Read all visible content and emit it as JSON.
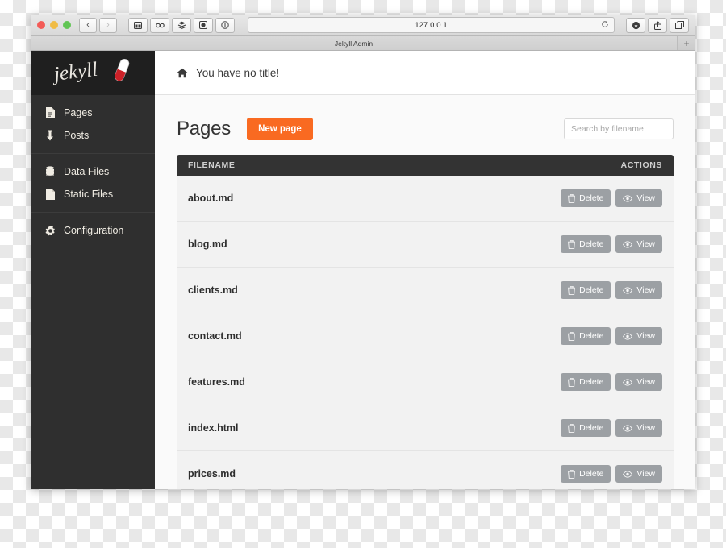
{
  "browser": {
    "url": "127.0.0.1",
    "tab_title": "Jekyll Admin",
    "new_tab_label": "+",
    "back_label": "‹",
    "forward_label": "›",
    "reload_label": "reload-icon",
    "toolbar_icons": [
      "sidebar-icon",
      "link-icon",
      "layers-icon",
      "camera-icon",
      "info-icon"
    ],
    "right_icons": [
      "downloads-icon",
      "share-icon",
      "tabs-icon"
    ],
    "traffic_lights": [
      "close-button",
      "minimize-button",
      "maximize-button"
    ]
  },
  "sidebar": {
    "brand": "jekyll",
    "groups": [
      {
        "items": [
          {
            "label": "Pages",
            "icon": "file-text-icon"
          },
          {
            "label": "Posts",
            "icon": "pin-icon"
          }
        ]
      },
      {
        "items": [
          {
            "label": "Data Files",
            "icon": "database-icon"
          },
          {
            "label": "Static Files",
            "icon": "file-icon"
          }
        ]
      },
      {
        "items": [
          {
            "label": "Configuration",
            "icon": "gear-icon"
          }
        ]
      }
    ]
  },
  "topbar": {
    "title": "You have no title!",
    "icon": "home-icon"
  },
  "page": {
    "title": "Pages",
    "new_button": "New page",
    "search_placeholder": "Search by filename",
    "search_value": ""
  },
  "table": {
    "headers": {
      "filename": "FILENAME",
      "actions": "ACTIONS"
    },
    "action_labels": {
      "delete": "Delete",
      "view": "View"
    },
    "rows": [
      {
        "filename": "about.md"
      },
      {
        "filename": "blog.md"
      },
      {
        "filename": "clients.md"
      },
      {
        "filename": "contact.md"
      },
      {
        "filename": "features.md"
      },
      {
        "filename": "index.html"
      },
      {
        "filename": "prices.md"
      }
    ]
  },
  "colors": {
    "accent_orange": "#f96a21",
    "sidebar_bg": "#2f2f2f",
    "brand_bg": "#1f1f1f",
    "table_head_bg": "#333333",
    "action_button_bg": "#9ca0a4",
    "row_bg": "#f2f2f2"
  }
}
